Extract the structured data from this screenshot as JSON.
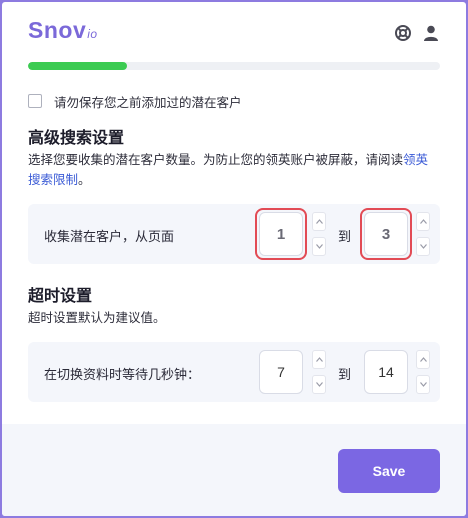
{
  "header": {
    "logo_main": "Snov",
    "logo_suffix": "io",
    "icons": [
      "support-icon",
      "user-icon"
    ]
  },
  "progress": {
    "fraction": 0.24,
    "color": "#3ccb52"
  },
  "options": {
    "dont_save_label": "请勿保存您之前添加过的潜在客户",
    "dont_save_checked": false
  },
  "advanced": {
    "title": "高级搜索设置",
    "description": "选择您要收集的潜在客户数量。为防止您的领英账户被屏蔽，请阅读",
    "link_text": "领英搜索限制",
    "desc_end": "。",
    "row_label": "收集潜在客户，从页面",
    "from_value": "1",
    "to_label": "到",
    "to_value": "3"
  },
  "timeout": {
    "title": "超时设置",
    "description": "超时设置默认为建议值。",
    "row_label": "在切换资料时等待几秒钟：",
    "from_value": "7",
    "to_label": "到",
    "to_value": "14"
  },
  "footer": {
    "save_label": "Save"
  },
  "colors": {
    "accent": "#7b67e3",
    "highlight_ring": "#e24b55",
    "link": "#3b5bd6"
  }
}
